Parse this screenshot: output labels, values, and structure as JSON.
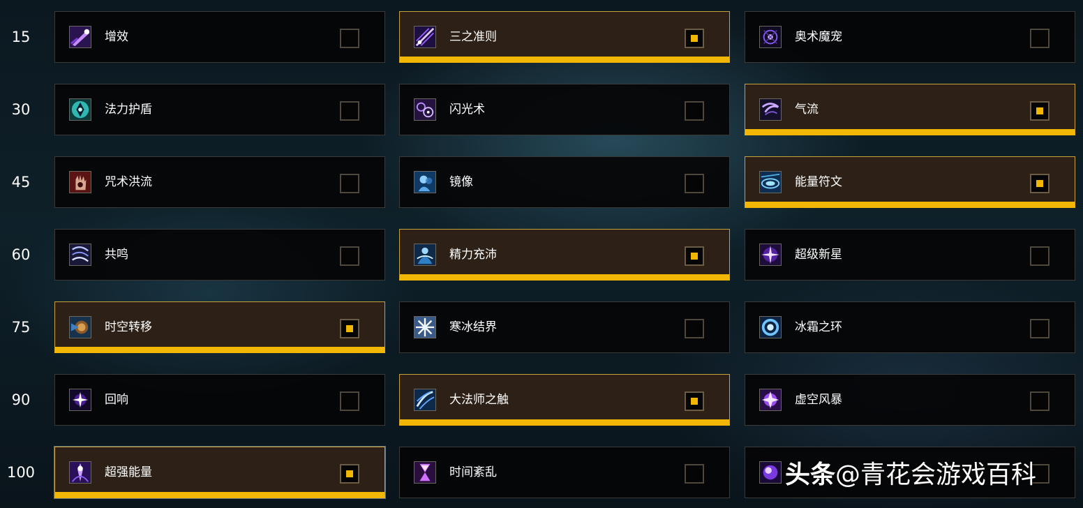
{
  "rows": [
    {
      "level": "15",
      "talents": [
        {
          "name": "增效",
          "icon": "purple-comet-icon",
          "selected": false
        },
        {
          "name": "三之准则",
          "icon": "arcane-missiles-icon",
          "selected": true
        },
        {
          "name": "奥术魔宠",
          "icon": "arcane-familiar-icon",
          "selected": false
        }
      ]
    },
    {
      "level": "30",
      "talents": [
        {
          "name": "法力护盾",
          "icon": "mana-shield-icon",
          "selected": false
        },
        {
          "name": "闪光术",
          "icon": "shimmer-icon",
          "selected": false
        },
        {
          "name": "气流",
          "icon": "slipstream-icon",
          "selected": true
        }
      ]
    },
    {
      "level": "45",
      "talents": [
        {
          "name": "咒术洪流",
          "icon": "incanters-flow-icon",
          "selected": false
        },
        {
          "name": "镜像",
          "icon": "mirror-image-icon",
          "selected": false
        },
        {
          "name": "能量符文",
          "icon": "rune-of-power-icon",
          "selected": true
        }
      ]
    },
    {
      "level": "60",
      "talents": [
        {
          "name": "共鸣",
          "icon": "resonance-icon",
          "selected": false
        },
        {
          "name": "精力充沛",
          "icon": "charged-up-icon",
          "selected": true
        },
        {
          "name": "超级新星",
          "icon": "supernova-icon",
          "selected": false
        }
      ]
    },
    {
      "level": "75",
      "talents": [
        {
          "name": "时空转移",
          "icon": "chrono-shift-icon",
          "selected": true
        },
        {
          "name": "寒冰结界",
          "icon": "ice-ward-icon",
          "selected": false
        },
        {
          "name": "冰霜之环",
          "icon": "ring-of-frost-icon",
          "selected": false
        }
      ]
    },
    {
      "level": "90",
      "talents": [
        {
          "name": "回响",
          "icon": "reverberate-icon",
          "selected": false
        },
        {
          "name": "大法师之触",
          "icon": "touch-of-the-magi-icon",
          "selected": true
        },
        {
          "name": "虚空风暴",
          "icon": "nether-tempest-icon",
          "selected": false
        }
      ]
    },
    {
      "level": "100",
      "talents": [
        {
          "name": "超强能量",
          "icon": "overpowered-icon",
          "selected": true
        },
        {
          "name": "时间紊乱",
          "icon": "time-anomaly-icon",
          "selected": false
        },
        {
          "name": "",
          "icon": "arcane-orb-icon",
          "selected": false
        }
      ]
    }
  ],
  "watermark": {
    "brand": "头条",
    "text": "@青花会游戏百科"
  },
  "colors": {
    "accent": "#f2b705",
    "selected_bg": "#2d2016",
    "cell_bg": "#050506"
  }
}
